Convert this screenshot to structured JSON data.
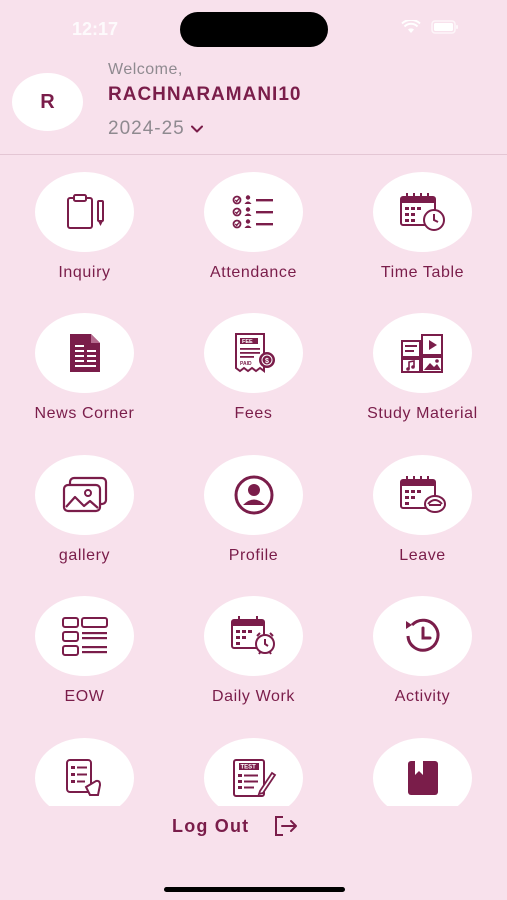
{
  "status_bar": {
    "time": "12:17"
  },
  "header": {
    "avatar_initial": "R",
    "welcome": "Welcome,",
    "username": "RACHNARAMANI10",
    "academic_year": "2024-25"
  },
  "menu": [
    {
      "label": "Inquiry",
      "icon": "clipboard-icon"
    },
    {
      "label": "Attendance",
      "icon": "attendance-checklist-icon"
    },
    {
      "label": "Time Table",
      "icon": "calendar-clock-icon"
    },
    {
      "label": "News Corner",
      "icon": "document-icon"
    },
    {
      "label": "Fees",
      "icon": "fee-receipt-icon"
    },
    {
      "label": "Study Material",
      "icon": "media-files-icon"
    },
    {
      "label": "gallery",
      "icon": "photo-gallery-icon"
    },
    {
      "label": "Profile",
      "icon": "user-profile-icon"
    },
    {
      "label": "Leave",
      "icon": "calendar-leave-icon"
    },
    {
      "label": "EOW",
      "icon": "list-layout-icon"
    },
    {
      "label": "Daily Work",
      "icon": "calendar-alarm-icon"
    },
    {
      "label": "Activity",
      "icon": "history-clock-icon"
    },
    {
      "label": "",
      "icon": "tablet-checklist-icon"
    },
    {
      "label": "",
      "icon": "test-paper-icon"
    },
    {
      "label": "",
      "icon": "bookmark-book-icon"
    }
  ],
  "footer": {
    "logout_label": "Log Out",
    "logout_icon": "logout-icon"
  },
  "colors": {
    "background": "#f8e1ec",
    "accent": "#7a1d4a",
    "muted": "#8f8a90",
    "tile": "#ffffff"
  }
}
